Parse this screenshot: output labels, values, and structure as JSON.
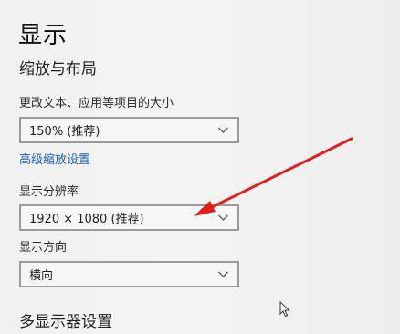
{
  "page": {
    "title": "显示"
  },
  "section_layout": {
    "title": "缩放与布局",
    "scale_label": "更改文本、应用等项目的大小",
    "scale_value": "150% (推荐)",
    "advanced_link": "高级缩放设置",
    "resolution_label": "显示分辨率",
    "resolution_value": "1920 × 1080 (推荐)",
    "orientation_label": "显示方向",
    "orientation_value": "横向"
  },
  "section_multi_display": {
    "title": "多显示器设置"
  },
  "annotation": {
    "arrow_color": "#e0201c"
  },
  "icons": {
    "dropdown": "chevron-down-icon",
    "cursor": "mouse-pointer-icon"
  }
}
